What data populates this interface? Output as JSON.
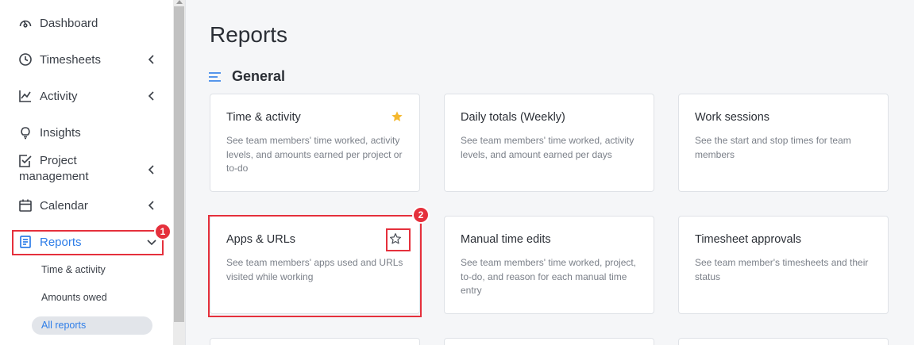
{
  "sidebar": {
    "items": [
      {
        "label": "Dashboard",
        "icon": "dashboard-gauge-icon"
      },
      {
        "label": "Timesheets",
        "icon": "clock-icon",
        "expandable": true
      },
      {
        "label": "Activity",
        "icon": "activity-chart-icon",
        "expandable": true
      },
      {
        "label": "Insights",
        "icon": "lightbulb-icon"
      },
      {
        "label_line1": "Project",
        "label_line2": "management",
        "icon": "checkbox-icon",
        "expandable": true
      },
      {
        "label": "Calendar",
        "icon": "calendar-icon",
        "expandable": true
      },
      {
        "label": "Reports",
        "icon": "report-document-icon",
        "expanded": true,
        "active": true
      }
    ],
    "sub_items": [
      {
        "label": "Time & activity"
      },
      {
        "label": "Amounts owed"
      },
      {
        "label": "All reports",
        "active": true
      }
    ],
    "badge_reports": "1"
  },
  "main": {
    "page_title": "Reports",
    "section_title": "General",
    "badge_card": "2",
    "cards": [
      {
        "title": "Time & activity",
        "description": "See team members' time worked, activity levels, and amounts earned per project or to-do",
        "favorited": true
      },
      {
        "title": "Daily totals (Weekly)",
        "description": "See team members' time worked, activity levels, and amount earned per days",
        "favorited": false
      },
      {
        "title": "Work sessions",
        "description": "See the start and stop times for team members",
        "favorited": false
      },
      {
        "title": "Apps & URLs",
        "description": "See team members' apps used and URLs visited while working",
        "favorited": false
      },
      {
        "title": "Manual time edits",
        "description": "See team members' time worked, project, to-do, and reason for each manual time entry",
        "favorited": false
      },
      {
        "title": "Timesheet approvals",
        "description": "See team member's timesheets and their status",
        "favorited": false
      }
    ]
  },
  "colors": {
    "accent": "#2f7ee8",
    "highlight_red": "#e5303c",
    "star_gold": "#f5b82e"
  }
}
